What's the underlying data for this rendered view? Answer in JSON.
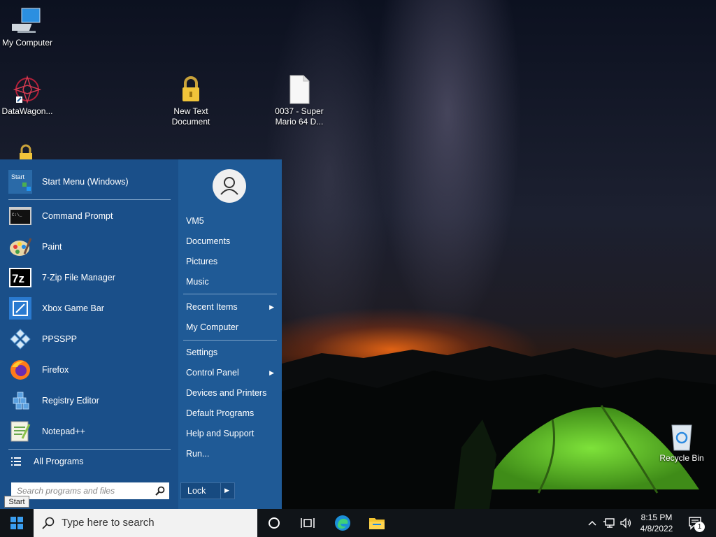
{
  "desktop": {
    "icons": [
      {
        "label": "My Computer",
        "icon": "computer-icon"
      },
      {
        "label": "DataWagon...",
        "icon": "datawagon-icon"
      },
      {
        "label": "New Text Document",
        "icon": "lock-file-icon"
      },
      {
        "label": "0037 - Super Mario 64 D...",
        "icon": "file-icon"
      },
      {
        "label": "Recycle Bin",
        "icon": "recycle-bin-icon"
      }
    ]
  },
  "start_menu": {
    "programs": [
      {
        "label": "Start Menu (Windows)",
        "icon": "start-menu-icon"
      },
      {
        "label": "Command Prompt",
        "icon": "cmd-icon"
      },
      {
        "label": "Paint",
        "icon": "paint-icon"
      },
      {
        "label": "7-Zip File Manager",
        "icon": "7zip-icon"
      },
      {
        "label": "Xbox Game Bar",
        "icon": "xbox-icon"
      },
      {
        "label": "PPSSPP",
        "icon": "ppsspp-icon"
      },
      {
        "label": "Firefox",
        "icon": "firefox-icon"
      },
      {
        "label": "Registry Editor",
        "icon": "registry-icon"
      },
      {
        "label": "Notepad++",
        "icon": "notepadpp-icon"
      }
    ],
    "all_programs": "All Programs",
    "search_placeholder": "Search programs and files",
    "right_items": [
      {
        "label": "VM5"
      },
      {
        "label": "Documents"
      },
      {
        "label": "Pictures"
      },
      {
        "label": "Music"
      },
      {
        "label": "Recent Items",
        "submenu": true
      },
      {
        "label": "My Computer"
      },
      {
        "label": "Settings"
      },
      {
        "label": "Control Panel",
        "submenu": true
      },
      {
        "label": "Devices and Printers"
      },
      {
        "label": "Default Programs"
      },
      {
        "label": "Help and Support"
      },
      {
        "label": "Run..."
      }
    ],
    "lock_label": "Lock",
    "start_icon_text": "Start"
  },
  "tooltip": "Start",
  "taskbar": {
    "search_text": "Type here to search",
    "time": "8:15 PM",
    "date": "4/8/2022",
    "notification_count": "1"
  },
  "colors": {
    "menu_left": "#1a4f89",
    "menu_right": "#1f5a96",
    "taskbar": "#101418"
  }
}
